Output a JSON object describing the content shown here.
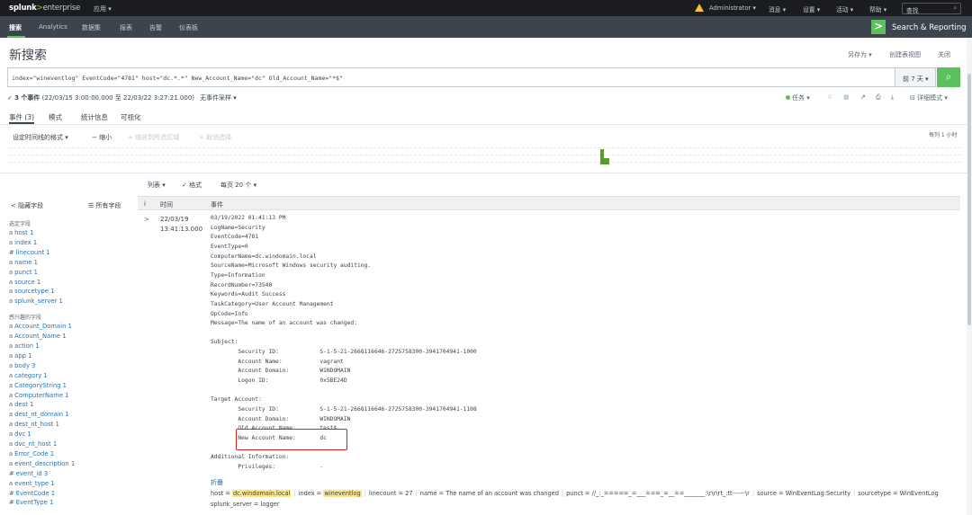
{
  "topbar": {
    "logo": "splunk",
    "logo_gt": ">",
    "logo_enterprise": "enterprise",
    "app_menu": "应用 ▾",
    "admin": "Administrator ▾",
    "messages": "消息 ▾",
    "settings": "设置 ▾",
    "activity": "活动 ▾",
    "help": "帮助 ▾",
    "search_placeholder": "查找"
  },
  "nav": {
    "items": [
      "搜索",
      "Analytics",
      "数据集",
      "报表",
      "告警",
      "仪表板"
    ],
    "app_name": "Search & Reporting"
  },
  "page": {
    "title": "新搜索",
    "save_as": "另存为 ▾",
    "create_dashboard": "创建表视图",
    "close": "关闭"
  },
  "search": {
    "query": "index=\"wineventlog\"  EventCode=\"4781\" host=\"dc.*.*\" New_Account_Name=\"dc\" Old_Account_Name=\"*$\"",
    "time_range": "前 7 天 ▾"
  },
  "status": {
    "events_prefix": "✓ ",
    "events_count": "3 个事件",
    "time_range": " (22/03/15 3:00:00.000 至 22/03/22 3:27:21.000)",
    "sampling": "无事件采样 ▾",
    "job": "任务 ▾",
    "mode": "⊟ 详细模式 ▾"
  },
  "tabs": [
    "事件 (3)",
    "模式",
    "统计信息",
    "可视化"
  ],
  "timeline": {
    "format": "设定时间线的格式 ▾",
    "zoom_out": "− 缩小",
    "zoom_sel": "+ 缩放到所选区域",
    "deselect": "× 取消选择",
    "per_col": "每列 1 小时"
  },
  "list_controls": {
    "list": "列表 ▾",
    "format": "✓ 格式",
    "per_page": "每页 20 个 ▾"
  },
  "sidebar": {
    "hide_fields": "< 隐藏字段",
    "all_fields": "☰ 所有字段",
    "selected_label": "选定字段",
    "selected": [
      {
        "t": "a",
        "name": "host 1"
      },
      {
        "t": "a",
        "name": "index 1"
      },
      {
        "t": "#",
        "name": "linecount 1"
      },
      {
        "t": "a",
        "name": "name 1"
      },
      {
        "t": "a",
        "name": "punct 1"
      },
      {
        "t": "a",
        "name": "source 1"
      },
      {
        "t": "a",
        "name": "sourcetype 1"
      },
      {
        "t": "a",
        "name": "splunk_server 1"
      }
    ],
    "interesting_label": "感兴趣的字段",
    "interesting": [
      {
        "t": "a",
        "name": "Account_Domain 1"
      },
      {
        "t": "a",
        "name": "Account_Name 1"
      },
      {
        "t": "a",
        "name": "action 1"
      },
      {
        "t": "a",
        "name": "app 1"
      },
      {
        "t": "a",
        "name": "body 3"
      },
      {
        "t": "a",
        "name": "category 1"
      },
      {
        "t": "a",
        "name": "CategoryString 1"
      },
      {
        "t": "a",
        "name": "ComputerName 1"
      },
      {
        "t": "a",
        "name": "dest 1"
      },
      {
        "t": "a",
        "name": "dest_nt_domain 1"
      },
      {
        "t": "a",
        "name": "dest_nt_host 1"
      },
      {
        "t": "a",
        "name": "dvc 1"
      },
      {
        "t": "a",
        "name": "dvc_nt_host 1"
      },
      {
        "t": "a",
        "name": "Error_Code 1"
      },
      {
        "t": "a",
        "name": "event_description 1"
      },
      {
        "t": "#",
        "name": "event_id 3"
      },
      {
        "t": "a",
        "name": "event_type 1"
      },
      {
        "t": "#",
        "name": "EventCode 1"
      },
      {
        "t": "#",
        "name": "EventType 1"
      }
    ]
  },
  "table": {
    "col_i": "i",
    "col_time": "时间",
    "col_event": "事件"
  },
  "event": {
    "expand": ">",
    "date": "22/03/19",
    "time": "13:41:13.000",
    "lines": [
      "03/19/2022 01:41:13 PM",
      "LogName=Security",
      "EventCode=4781",
      "EventType=0",
      "ComputerName=dc.windomain.local",
      "SourceName=Microsoft Windows security auditing.",
      "Type=Information",
      "RecordNumber=73540",
      "Keywords=Audit Success",
      "TaskCategory=User Account Management",
      "OpCode=Info",
      "Message=The name of an account was changed:",
      "",
      "Subject:",
      "        Security ID:            S-1-5-21-2668116646-2725758300-3941704941-1000",
      "        Account Name:           vagrant",
      "        Account Domain:         WINDOMAIN",
      "        Logon ID:               0x5BE24D",
      "",
      "Target Account:",
      "        Security ID:            S-1-5-21-2668116646-2725758300-3941704941-1108",
      "        Account Domain:         WINDOMAIN",
      "        Old Account Name:       test$",
      "        New Account Name:       dc",
      "",
      "Additional Information:",
      "        Privileges:             -"
    ],
    "collapse": "折叠",
    "fields": [
      {
        "k": "host = ",
        "v": "dc.windomain.local",
        "hl": true
      },
      {
        "k": "index = ",
        "v": "wineventlog",
        "hl": true
      },
      {
        "k": "linecount = ",
        "v": "27",
        "hl": false
      },
      {
        "k": "name = ",
        "v": "The name of an account was changed",
        "hl": false
      },
      {
        "k": "punct = ",
        "v": "//_:_=====_=___===_=__==_______:\\r\\r\\rt_:tt------\\r",
        "hl": false
      },
      {
        "k": "source = ",
        "v": "WinEventLog:Security",
        "hl": false
      },
      {
        "k": "sourcetype = ",
        "v": "WinEventLog",
        "hl": false
      }
    ],
    "splunk_server": "splunk_server = logger"
  }
}
